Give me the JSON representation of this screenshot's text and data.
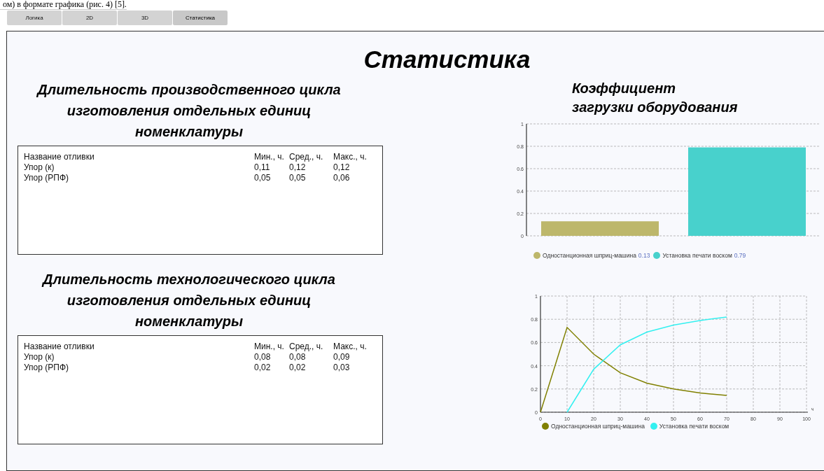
{
  "document_text": "ом) в формате графика (рис. 4) [5].",
  "tabs": [
    {
      "label": "Логика",
      "selected": false
    },
    {
      "label": "2D",
      "selected": false
    },
    {
      "label": "3D",
      "selected": false
    },
    {
      "label": "Статистика",
      "selected": true
    }
  ],
  "page_title": "Статистика",
  "tables": [
    {
      "title": "Длительность производственного цикла изготовления отдельных единиц номенклатуры",
      "columns": [
        "Название отливки",
        "Мин., ч.",
        "Сред., ч.",
        "Макс., ч."
      ],
      "rows": [
        [
          "Упор (к)",
          "0,11",
          "0,12",
          "0,12"
        ],
        [
          "Упор (РПФ)",
          "0,05",
          "0,05",
          "0,06"
        ]
      ]
    },
    {
      "title": "Длительность технологического цикла изготовления отдельных единиц номенклатуры",
      "columns": [
        "Название отливки",
        "Мин., ч.",
        "Сред., ч.",
        "Макс., ч."
      ],
      "rows": [
        [
          "Упор (к)",
          "0,08",
          "0,08",
          "0,09"
        ],
        [
          "Упор (РПФ)",
          "0,02",
          "0,02",
          "0,03"
        ]
      ]
    }
  ],
  "load_panel": {
    "title": "Коэффициент\nзагрузки оборудования",
    "legend_values": [
      "0.13",
      "0.79"
    ],
    "chart_data": {
      "type": "bar",
      "grid": true,
      "ylim": [
        0,
        1
      ],
      "yticks": [
        0,
        {
          "value": 0.2,
          "label": "0.2"
        },
        {
          "value": 0.4,
          "label": "0.4"
        },
        {
          "value": 0.6,
          "label": "0.6"
        },
        {
          "value": 0.8,
          "label": "0.8"
        },
        1
      ],
      "series": [
        {
          "name": "Одностанционная шприц-машина",
          "color": "#bdb76b",
          "values": [
            0.13
          ]
        },
        {
          "name": "Установка печати воском",
          "color": "#48d1cc",
          "values": [
            0.79
          ]
        }
      ]
    }
  },
  "timeline_panel": {
    "chart_data": {
      "type": "line",
      "grid": true,
      "xlabel": "ч",
      "x": [
        0,
        10,
        20,
        30,
        40,
        50,
        60,
        70
      ],
      "xlim": [
        0,
        100
      ],
      "ylim": [
        0,
        1
      ],
      "xticks": [
        0,
        10,
        20,
        30,
        40,
        50,
        60,
        70,
        80,
        90,
        100
      ],
      "yticks": [
        0,
        {
          "value": 0.2,
          "label": "0.2"
        },
        {
          "value": 0.4,
          "label": "0.4"
        },
        {
          "value": 0.6,
          "label": "0.6"
        },
        {
          "value": 0.8,
          "label": "0.8"
        },
        1
      ],
      "series": [
        {
          "name": "Одностанционная шприц-машина",
          "color": "#808000",
          "values": [
            0,
            0.73,
            0.5,
            0.34,
            0.25,
            0.2,
            0.165,
            0.145
          ]
        },
        {
          "name": "Установка печати воском",
          "color": "#33f0f0",
          "values": [
            null,
            0,
            0.37,
            0.58,
            0.69,
            0.75,
            0.79,
            0.82
          ]
        }
      ]
    }
  }
}
